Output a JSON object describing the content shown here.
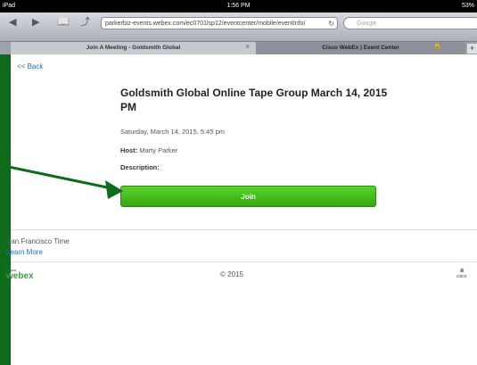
{
  "statusbar": {
    "left": "iPad",
    "time": "1:56 PM",
    "battery": "53%"
  },
  "toolbar": {
    "url": "parkerbiz-events.webex.com/ec0701lsp12/eventcenter/mobile/eventInfo/",
    "search_placeholder": "Google"
  },
  "tabs": [
    {
      "label": "Join A Meeting - Goldsmith Global"
    },
    {
      "label": "Cisco WebEx | Event Center"
    }
  ],
  "page": {
    "back_label": "<< Back",
    "title": "Goldsmith Global Online Tape Group March 14, 2015 PM",
    "date": "Saturday, March 14, 2015, 5:45 pm",
    "host_label": "Host:",
    "host_name": "Marty Parker",
    "description_label": "Description:",
    "join_label": "Join",
    "timezone": "San Francisco Time",
    "learn_more": "Learn More",
    "copyright": "© 2015",
    "webex_brand": "webex",
    "webex_sub": "Cisco",
    "cisco_brand": "cisco"
  },
  "colors": {
    "accent": "#36a80e",
    "link": "#1a73c7",
    "annotation": "#0d6b1a"
  }
}
